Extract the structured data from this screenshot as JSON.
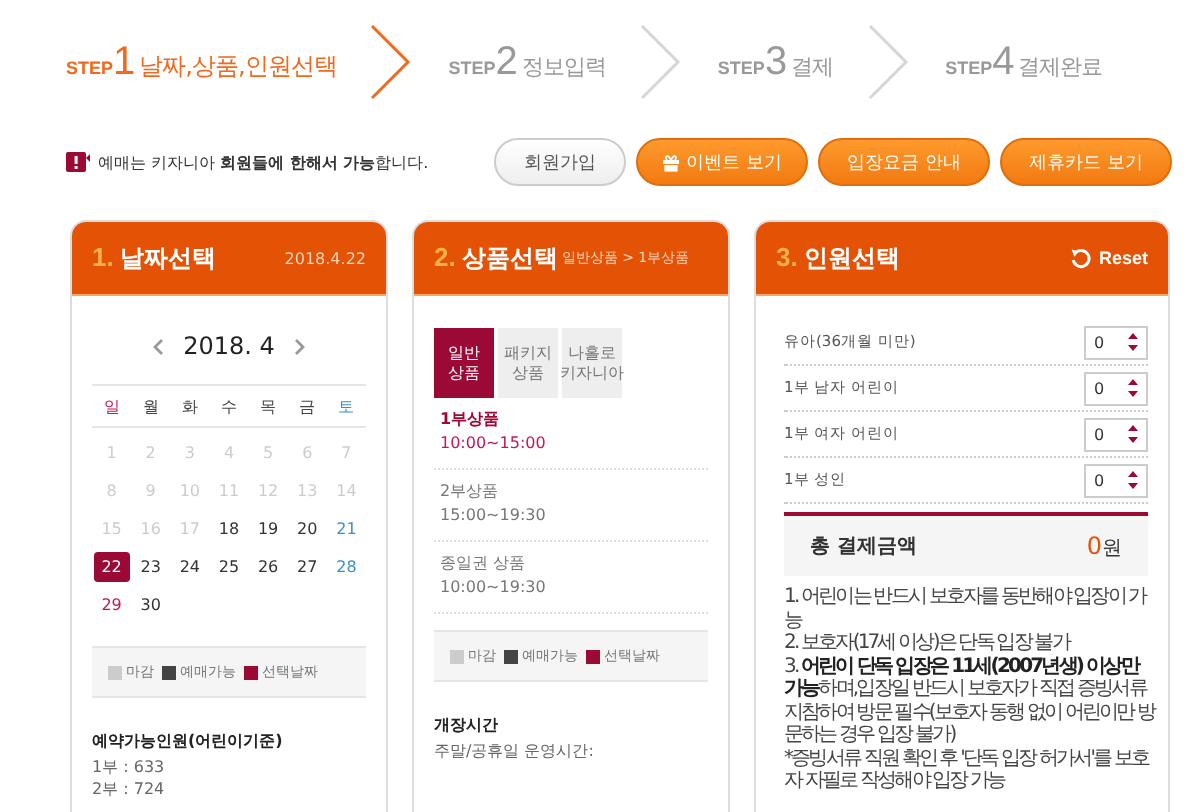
{
  "steps": [
    {
      "prefix": "STEP",
      "number": "1",
      "label": "날짜,상품,인원선택",
      "selected": true
    },
    {
      "prefix": "STEP",
      "number": "2",
      "label": "정보입력",
      "selected": false
    },
    {
      "prefix": "STEP",
      "number": "3",
      "label": "결제",
      "selected": false
    },
    {
      "prefix": "STEP",
      "number": "4",
      "label": "결제완료",
      "selected": false
    }
  ],
  "notice": {
    "text": "예매는 키자니아 **회원들에 한해서 가능**합니다."
  },
  "buttons": [
    {
      "label": "회원가입",
      "kind": "plain"
    },
    {
      "label": "이벤트 보기",
      "kind": "gift"
    },
    {
      "label": "입장요금 안내",
      "kind": "orange"
    },
    {
      "label": "제휴카드 보기",
      "kind": "orange"
    }
  ],
  "date_panel": {
    "number": "1.",
    "title": "날짜선택",
    "date": "2018.4.22",
    "month": "2018. 4",
    "weekdays": [
      "일",
      "월",
      "화",
      "수",
      "목",
      "금",
      "토"
    ],
    "days": [
      {
        "day": "1",
        "available": false,
        "selected": false
      },
      {
        "day": "2",
        "available": false,
        "selected": false
      },
      {
        "day": "3",
        "available": false,
        "selected": false
      },
      {
        "day": "4",
        "available": false,
        "selected": false
      },
      {
        "day": "5",
        "available": false,
        "selected": false
      },
      {
        "day": "6",
        "available": false,
        "selected": false
      },
      {
        "day": "7",
        "available": false,
        "selected": false
      },
      {
        "day": "8",
        "available": false,
        "selected": false
      },
      {
        "day": "9",
        "available": false,
        "selected": false
      },
      {
        "day": "10",
        "available": false,
        "selected": false
      },
      {
        "day": "11",
        "available": false,
        "selected": false
      },
      {
        "day": "12",
        "available": false,
        "selected": false
      },
      {
        "day": "13",
        "available": false,
        "selected": false
      },
      {
        "day": "14",
        "available": false,
        "selected": false
      },
      {
        "day": "15",
        "available": false,
        "selected": false
      },
      {
        "day": "16",
        "available": false,
        "selected": false
      },
      {
        "day": "17",
        "available": false,
        "selected": false
      },
      {
        "day": "18",
        "available": true,
        "selected": false
      },
      {
        "day": "19",
        "available": true,
        "selected": false
      },
      {
        "day": "20",
        "available": true,
        "selected": false
      },
      {
        "day": "21",
        "available": true,
        "selected": false
      },
      {
        "day": "22",
        "available": true,
        "selected": true
      },
      {
        "day": "23",
        "available": true,
        "selected": false
      },
      {
        "day": "24",
        "available": true,
        "selected": false
      },
      {
        "day": "25",
        "available": true,
        "selected": false
      },
      {
        "day": "26",
        "available": true,
        "selected": false
      },
      {
        "day": "27",
        "available": true,
        "selected": false
      },
      {
        "day": "28",
        "available": true,
        "selected": false
      },
      {
        "day": "29",
        "available": true,
        "selected": false
      },
      {
        "day": "30",
        "available": true,
        "selected": false
      }
    ],
    "legend": [
      {
        "label": "마감",
        "color": "#cccccc"
      },
      {
        "label": "예매가능",
        "color": "#444444"
      },
      {
        "label": "선택날짜",
        "color": "#9b0a35"
      }
    ],
    "capacity_title": "예약가능인원(어린이기준)",
    "capacity": [
      "1부 : 633",
      "2부 : 724"
    ]
  },
  "product_panel": {
    "number": "2.",
    "title": "상품선택",
    "breadcrumb": "일반상품 > 1부상품",
    "tabs": [
      {
        "label": "일반\n상품",
        "selected": true
      },
      {
        "label": "패키지\n상품",
        "selected": false
      },
      {
        "label": "나홀로\n키자니아",
        "selected": false
      }
    ],
    "products": [
      {
        "name": "1부상품",
        "time": "10:00~15:00",
        "selected": true
      },
      {
        "name": "2부상품",
        "time": "15:00~19:30",
        "selected": false
      },
      {
        "name": "종일권 상품",
        "time": "10:00~19:30",
        "selected": false
      }
    ],
    "legend": [
      {
        "label": "마감",
        "color": "#cccccc"
      },
      {
        "label": "예매가능",
        "color": "#444444"
      },
      {
        "label": "선택날짜",
        "color": "#9b0a35"
      }
    ],
    "hours_title": "개장시간",
    "hours": "주말/공휴일 운영시간:"
  },
  "people_panel": {
    "number": "3.",
    "title": "인원선택",
    "reset": "Reset",
    "rows": [
      {
        "label": "유아(36개월 미만)",
        "value": "0"
      },
      {
        "label": "1부 남자 어린이",
        "value": "0"
      },
      {
        "label": "1부 여자 어린이",
        "value": "0"
      },
      {
        "label": "1부 성인",
        "value": "0"
      }
    ],
    "total_label": "총 결제금액",
    "total_amount": "0",
    "total_unit": "원",
    "notes": [
      "1. 어린이는 반드시 보호자를 동반해야 입장이 가능",
      "2. 보호자(17세 이상)은 단독 입장 불가",
      "3. **어린이 단독 입장은 11세(2007년생) 이상만 가능**하며,입장일 반드시 보호자가 직접 증빙서류 지참하여 방문 필수(보호자 동행 없이 어린이만 방문하는 경우 입장 불가)",
      "*증빙서류 직원 확인 후 '단독 입장 허가서'를 보호자 자필로 작성해야 입장 가능"
    ]
  }
}
